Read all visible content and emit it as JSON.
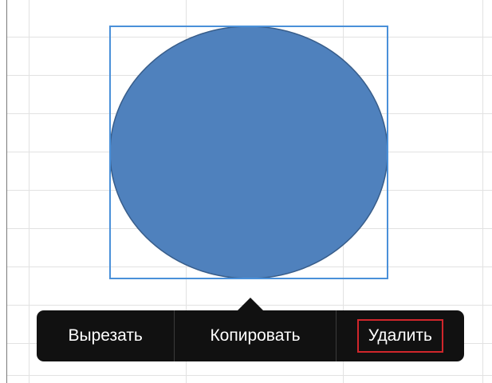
{
  "sheet": {
    "grid_color": "#e2e2e2"
  },
  "shape": {
    "fill_color": "#4f81bd",
    "outline_color": "#385d8a",
    "selection_color": "#4a90d9"
  },
  "context_menu": {
    "items": [
      {
        "label": "Вырезать"
      },
      {
        "label": "Копировать"
      },
      {
        "label": "Удалить"
      }
    ],
    "highlight_color": "#d0262b"
  }
}
